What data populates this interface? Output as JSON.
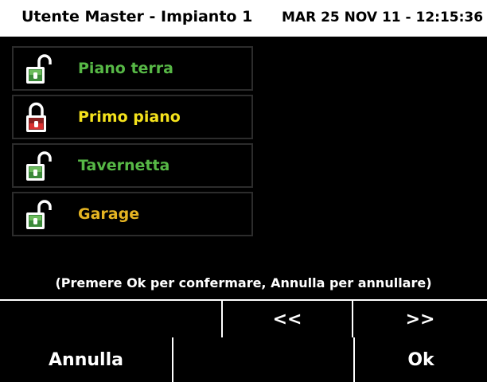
{
  "header": {
    "title": "Utente Master - Impianto 1",
    "datetime": "MAR 25 NOV 11 - 12:15:36"
  },
  "zones": [
    {
      "name": "Piano terra",
      "state": "open-lock-icon",
      "color": "#57b846"
    },
    {
      "name": "Primo piano",
      "state": "closed-lock-icon",
      "color": "#f4e21c"
    },
    {
      "name": "Tavernetta",
      "state": "open-lock-icon",
      "color": "#57b846"
    },
    {
      "name": "Garage",
      "state": "open-lock-icon",
      "color": "#e5b422"
    }
  ],
  "hint": "(Premere Ok per confermare, Annulla per annullare)",
  "nav": {
    "prev_label": "<<",
    "next_label": ">>"
  },
  "footer": {
    "cancel_label": "Annulla",
    "ok_label": "Ok"
  }
}
